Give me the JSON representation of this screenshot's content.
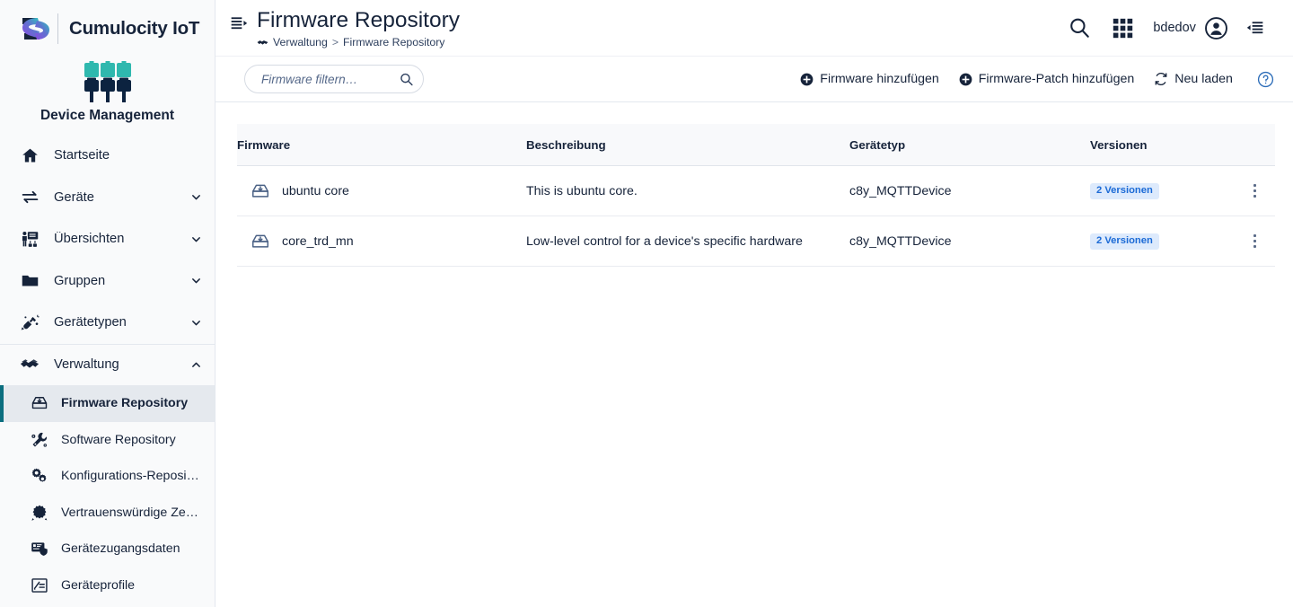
{
  "brand": {
    "logo_icon": "software-ag-s-logo",
    "name": "Cumulocity IoT",
    "app_icon": "device-management-plugs-icon",
    "app_title": "Device Management"
  },
  "sidebar": {
    "items": [
      {
        "label": "Startseite",
        "icon": "home-icon",
        "expandable": false,
        "key": "startseite"
      },
      {
        "label": "Geräte",
        "icon": "transfer-arrows-icon",
        "expandable": true,
        "expanded": false,
        "key": "geraete"
      },
      {
        "label": "Übersichten",
        "icon": "presentation-icon",
        "expandable": true,
        "expanded": false,
        "key": "uebersichten"
      },
      {
        "label": "Gruppen",
        "icon": "folder-icon",
        "expandable": true,
        "expanded": false,
        "key": "gruppen"
      },
      {
        "label": "Gerätetypen",
        "icon": "plug-connect-icon",
        "expandable": true,
        "expanded": false,
        "key": "geraetetypen"
      },
      {
        "label": "Verwaltung",
        "icon": "handshake-icon",
        "expandable": true,
        "expanded": true,
        "key": "verwaltung"
      }
    ],
    "subitems": [
      {
        "label": "Firmware Repository",
        "icon": "firmware-archive-icon",
        "active": true,
        "key": "firmware-repository"
      },
      {
        "label": "Software Repository",
        "icon": "wrench-gear-icon",
        "active": false,
        "key": "software-repository"
      },
      {
        "label": "Konfigurations-Reposi…",
        "icon": "gears-icon",
        "active": false,
        "key": "konfigurations-repository"
      },
      {
        "label": "Vertrauenswürdige Ze…",
        "icon": "certificate-icon",
        "active": false,
        "key": "vertrauenswuerdige-zertifikate"
      },
      {
        "label": "Gerätezugangsdaten",
        "icon": "device-shield-icon",
        "active": false,
        "key": "geraetezugangsdaten"
      },
      {
        "label": "Geräteprofile",
        "icon": "profile-list-icon",
        "active": false,
        "key": "geraeteprofile"
      }
    ]
  },
  "header": {
    "panel_toggle_icon": "collapse-left-panel-icon",
    "title": "Firmware Repository",
    "breadcrumb": {
      "icon": "handshake-icon",
      "root": "Verwaltung",
      "separator": ">",
      "current": "Firmware Repository"
    },
    "search_icon": "search-icon",
    "apps_icon": "app-switcher-grid-icon",
    "user": "bdedov",
    "user_icon": "user-avatar-icon",
    "right_panel_icon": "collapse-right-panel-icon"
  },
  "toolbar": {
    "filter_placeholder": "Firmware filtern…",
    "filter_value": "",
    "filter_icon": "search-icon",
    "add_firmware_label": "Firmware hinzufügen",
    "add_firmware_patch_label": "Firmware-Patch hinzufügen",
    "reload_label": "Neu laden",
    "reload_icon": "refresh-icon",
    "plus_icon": "plus-circle-icon",
    "help_icon": "help-circle-icon"
  },
  "table": {
    "columns": {
      "firmware": "Firmware",
      "description": "Beschreibung",
      "device_type": "Gerätetyp",
      "versions": "Versionen"
    },
    "rows": [
      {
        "icon": "firmware-archive-icon",
        "name": "ubuntu core",
        "description": "This is ubuntu core.",
        "device_type": "c8y_MQTTDevice",
        "versions_badge": "2 Versionen",
        "menu_icon": "kebab-menu-icon"
      },
      {
        "icon": "firmware-archive-icon",
        "name": "core_trd_mn",
        "description": "Low-level control for a device's specific hardware",
        "device_type": "c8y_MQTTDevice",
        "versions_badge": "2 Versionen",
        "menu_icon": "kebab-menu-icon"
      }
    ]
  },
  "colors": {
    "brand_dark": "#16233a",
    "accent_teal": "#0b6e7f",
    "badge_bg": "#ddeafc",
    "badge_text": "#1b6ad6",
    "sidebar_bg": "#f9fafb",
    "active_item_bg": "#e5e9ee",
    "logo_gradient_start": "#8b4ae2",
    "logo_gradient_end": "#2fc3bd"
  }
}
